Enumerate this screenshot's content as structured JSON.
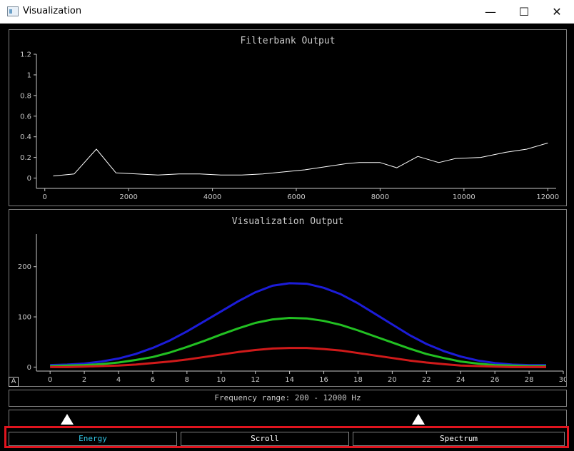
{
  "window": {
    "title": "Visualization",
    "controls": {
      "minimize": "—",
      "maximize": "☐",
      "close": "✕"
    }
  },
  "filterbank": {
    "title": "Filterbank Output"
  },
  "visualization": {
    "title": "Visualization Output",
    "autoscale_label": "A"
  },
  "frequency_range": {
    "text": "Frequency range: 200 - 12000 Hz"
  },
  "slider": {
    "low_hz": 200,
    "high_hz": 12000
  },
  "tabs": [
    {
      "label": "Energy",
      "active": true
    },
    {
      "label": "Scroll",
      "active": false
    },
    {
      "label": "Spectrum",
      "active": false
    }
  ],
  "colors": {
    "active_tab": "#31c8e8",
    "red": "#d01a1a",
    "green": "#22c022",
    "blue": "#1c1cd8",
    "highlight": "#e0141e"
  },
  "chart_data": [
    {
      "type": "line",
      "title": "Filterbank Output",
      "xlim": [
        -200,
        12200
      ],
      "ylim": [
        -0.1,
        1.2
      ],
      "x_ticks": [
        0,
        2000,
        4000,
        6000,
        8000,
        10000,
        12000
      ],
      "y_ticks": [
        0,
        0.2,
        0.4,
        0.6,
        0.8,
        1,
        1.2
      ],
      "series": [
        {
          "x": [
            200,
            700,
            1230,
            1700,
            2200,
            2700,
            3200,
            3700,
            4200,
            4700,
            5200,
            5700,
            6200,
            6700,
            7200,
            7500,
            8000,
            8400,
            8900,
            9400,
            9800,
            10400,
            11000,
            11500,
            12000
          ],
          "values": [
            0.02,
            0.04,
            0.28,
            0.05,
            0.04,
            0.03,
            0.04,
            0.04,
            0.03,
            0.03,
            0.04,
            0.06,
            0.08,
            0.11,
            0.14,
            0.15,
            0.15,
            0.1,
            0.21,
            0.15,
            0.19,
            0.2,
            0.25,
            0.28,
            0.34
          ]
        }
      ]
    },
    {
      "type": "line",
      "title": "Visualization Output",
      "xlim": [
        -0.8,
        30
      ],
      "ylim": [
        -8,
        265
      ],
      "x_ticks": [
        0,
        2,
        4,
        6,
        8,
        10,
        12,
        14,
        16,
        18,
        20,
        22,
        24,
        26,
        28,
        30
      ],
      "y_ticks": [
        0,
        100,
        200
      ],
      "x": [
        0,
        1,
        2,
        3,
        4,
        5,
        6,
        7,
        8,
        9,
        10,
        11,
        12,
        13,
        14,
        15,
        16,
        17,
        18,
        19,
        20,
        21,
        22,
        23,
        24,
        25,
        26,
        27,
        28,
        29
      ],
      "series": [
        {
          "color": "#1c1cd8",
          "values": [
            4,
            5,
            7,
            11,
            17,
            26,
            38,
            53,
            71,
            91,
            111,
            131,
            149,
            162,
            167,
            166,
            158,
            145,
            127,
            106,
            85,
            64,
            46,
            32,
            21,
            13,
            8,
            5,
            4,
            4
          ]
        },
        {
          "color": "#22c022",
          "values": [
            2,
            3,
            4,
            6,
            9,
            14,
            20,
            29,
            40,
            52,
            65,
            77,
            88,
            95,
            98,
            97,
            92,
            84,
            73,
            61,
            49,
            37,
            26,
            18,
            11,
            7,
            4,
            3,
            2,
            2
          ]
        },
        {
          "color": "#d01a1a",
          "values": [
            0,
            0,
            1,
            2,
            3,
            5,
            8,
            11,
            15,
            20,
            25,
            30,
            34,
            37,
            38,
            38,
            36,
            33,
            28,
            23,
            18,
            13,
            9,
            6,
            3,
            2,
            1,
            0,
            0,
            0
          ]
        }
      ]
    }
  ]
}
